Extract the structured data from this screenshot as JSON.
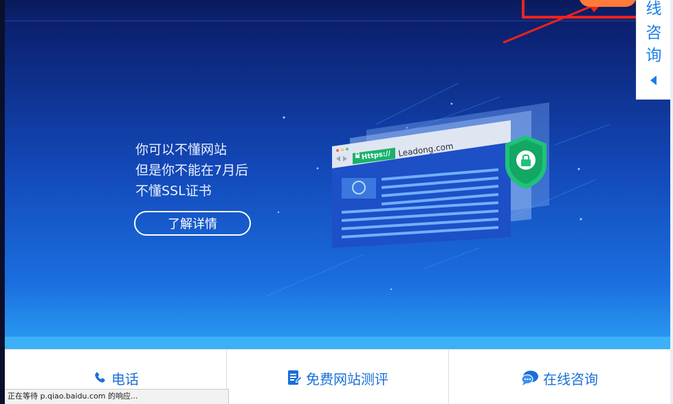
{
  "colors": {
    "hero_top": "#0b1f6d",
    "hero_bottom": "#2b9ff2",
    "accent_blue": "#1a6fd8",
    "shield_green": "#1fc27a",
    "annotation_red": "#f0231a",
    "cta_orange": "#ff7b3a"
  },
  "hero": {
    "line1": "你可以不懂网站",
    "line2": "但是你不能在7月后",
    "line3": "不懂SSL证书",
    "detail_button": "了解详情"
  },
  "illustration": {
    "https_label": "Https://",
    "url": "Leadong.com",
    "icons": [
      "lock-icon",
      "shield-icon",
      "chrome-icon"
    ]
  },
  "side_tab": {
    "chars": [
      "线",
      "咨",
      "询"
    ],
    "arrow_icon": "caret-left-icon"
  },
  "bottom_bar": {
    "items": [
      {
        "label": "电话",
        "icon": "phone-icon"
      },
      {
        "label": "免费网站测评",
        "icon": "document-icon"
      },
      {
        "label": "在线咨询",
        "icon": "chat-bubble-icon"
      }
    ]
  },
  "status_bar": {
    "text": "正在等待 p.qiao.baidu.com 的响应..."
  }
}
